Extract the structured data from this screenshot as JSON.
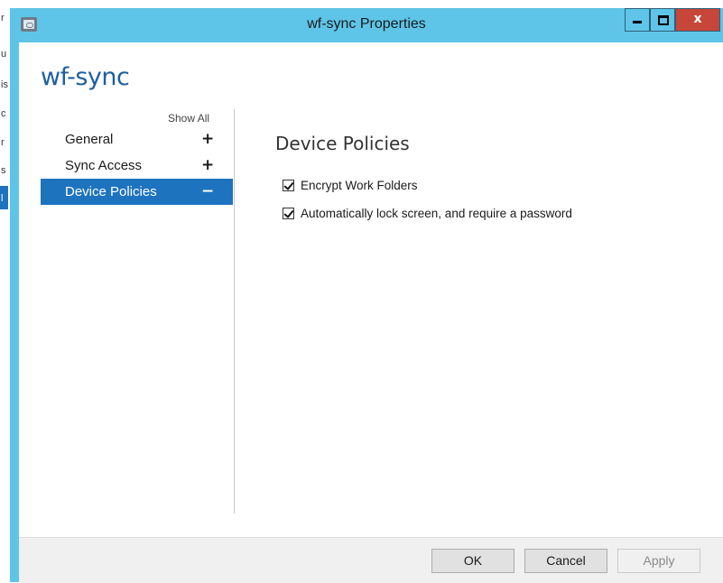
{
  "window": {
    "title": "wf-sync Properties",
    "close_glyph": "x"
  },
  "dialog": {
    "heading": "wf-sync",
    "show_all": "Show All"
  },
  "nav": {
    "items": [
      {
        "label": "General",
        "sign": "+",
        "active": false
      },
      {
        "label": "Sync Access",
        "sign": "+",
        "active": false
      },
      {
        "label": "Device Policies",
        "sign": "−",
        "active": true
      }
    ]
  },
  "section": {
    "title": "Device Policies",
    "options": [
      {
        "label": "Encrypt Work Folders",
        "checked": true
      },
      {
        "label": "Automatically lock screen, and require a password",
        "checked": true
      }
    ]
  },
  "footer": {
    "ok": "OK",
    "cancel": "Cancel",
    "apply": "Apply"
  },
  "background": {
    "letters": [
      "r",
      "u",
      "is",
      "c",
      "r",
      "s",
      "l"
    ]
  },
  "colors": {
    "titlebar": "#5ec5e8",
    "accent": "#1e73be",
    "heading": "#1f5fa0",
    "close": "#c7463a"
  }
}
